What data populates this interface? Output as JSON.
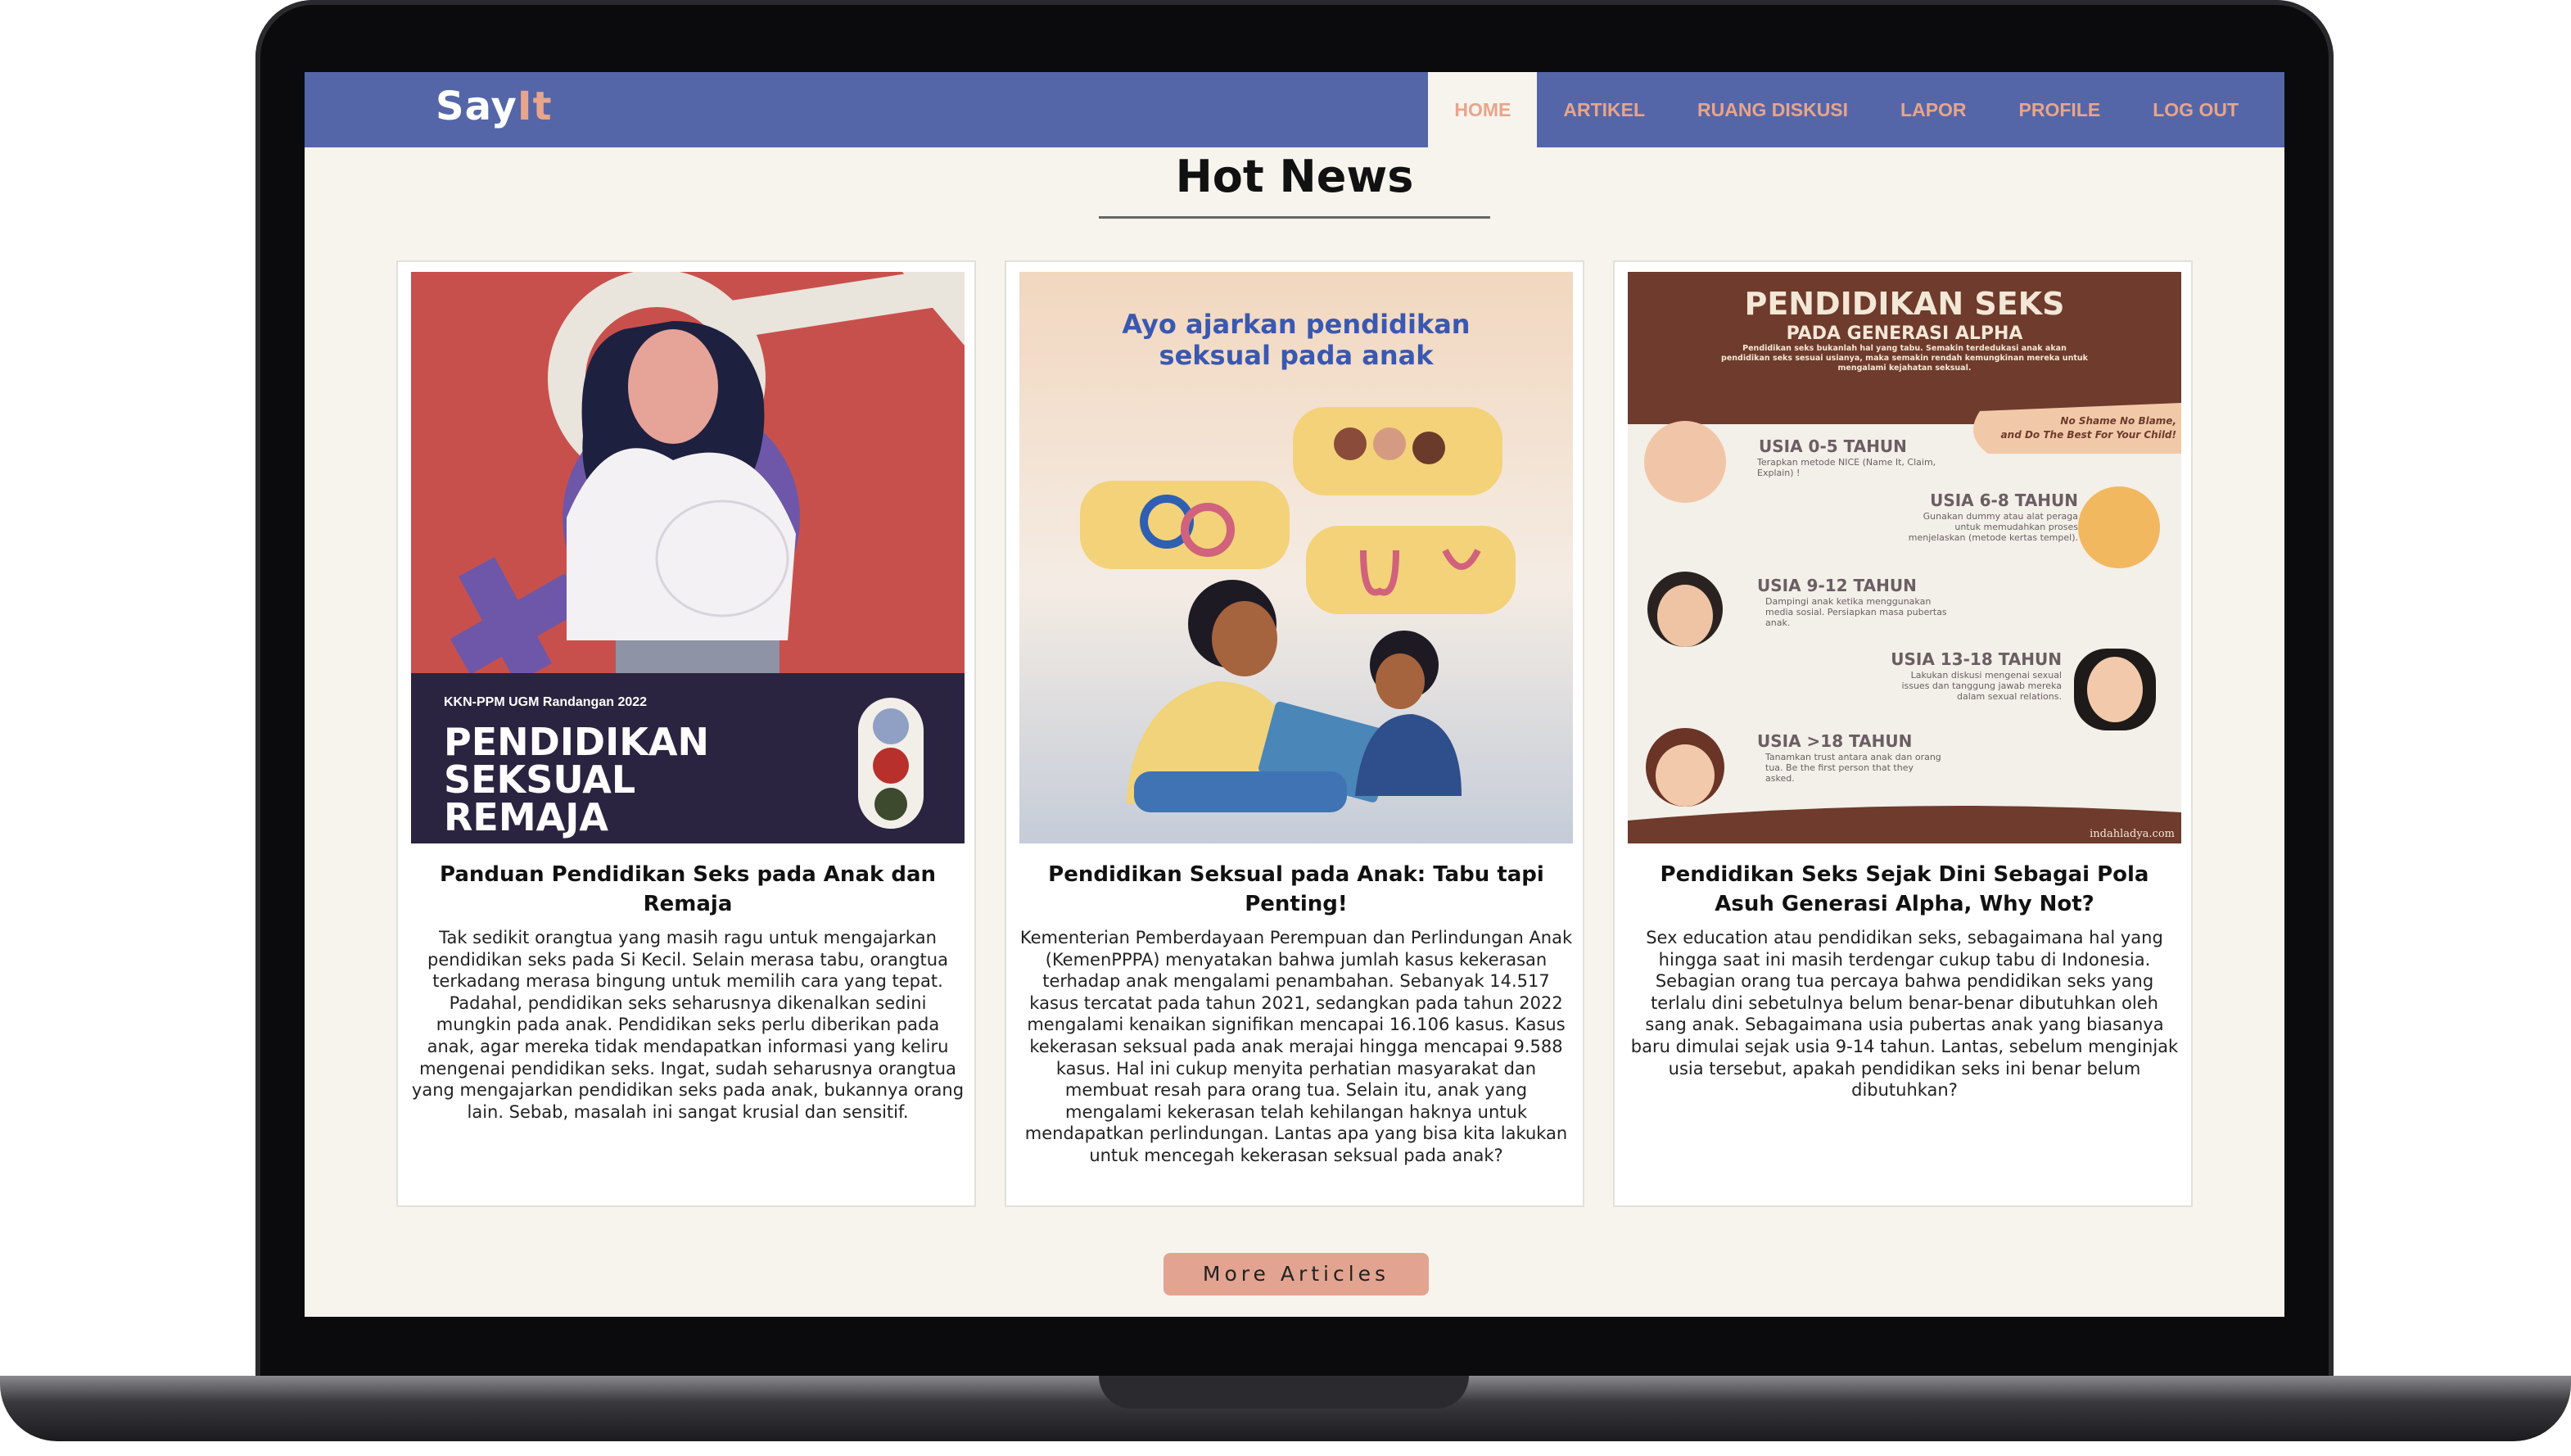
{
  "nav": {
    "logo_main": "Say",
    "logo_accent": "It",
    "items": [
      {
        "label": "HOME",
        "active": true
      },
      {
        "label": "ARTIKEL",
        "active": false
      },
      {
        "label": "RUANG DISKUSI",
        "active": false
      },
      {
        "label": "LAPOR",
        "active": false
      },
      {
        "label": "PROFILE",
        "active": false
      },
      {
        "label": "LOG OUT",
        "active": false
      }
    ]
  },
  "heading": "Hot News",
  "cards": [
    {
      "title": "Panduan Pendidikan Seks pada Anak dan Remaja",
      "body": "Tak sedikit orangtua yang masih ragu untuk mengajarkan pendidikan seks pada Si Kecil. Selain merasa tabu, orangtua terkadang merasa bingung untuk memilih cara yang tepat. Padahal, pendidikan seks seharusnya dikenalkan sedini mungkin pada anak. Pendidikan seks perlu diberikan pada anak, agar mereka tidak mendapatkan informasi yang keliru mengenai pendidikan seks. Ingat, sudah seharusnya orangtua yang mengajarkan pendidikan seks pada anak, bukannya orang lain. Sebab, masalah ini sangat krusial dan sensitif.",
      "image": {
        "caption_small": "KKN-PPM UGM Randangan 2022",
        "caption_big": [
          "PENDIDIKAN",
          "SEKSUAL",
          "REMAJA"
        ]
      }
    },
    {
      "title": "Pendidikan Seksual pada Anak: Tabu tapi Penting!",
      "body": "Kementerian Pemberdayaan Perempuan dan Perlindungan Anak (KemenPPPA) menyatakan bahwa jumlah kasus kekerasan terhadap anak mengalami penambahan. Sebanyak 14.517 kasus tercatat pada tahun 2021, sedangkan pada tahun 2022 mengalami kenaikan signifikan mencapai 16.106 kasus. Kasus kekerasan seksual pada anak merajai hingga mencapai 9.588 kasus. Hal ini cukup menyita perhatian masyarakat dan membuat resah para orang tua. Selain itu, anak yang mengalami kekerasan telah kehilangan haknya untuk mendapatkan perlindungan. Lantas apa yang bisa kita lakukan untuk mencegah kekerasan seksual pada anak?",
      "image": {
        "caption": [
          "Ayo ajarkan pendidikan",
          "seksual pada anak"
        ]
      }
    },
    {
      "title": "Pendidikan Seks Sejak Dini Sebagai Pola Asuh Generasi Alpha, Why Not?",
      "body": "Sex education atau pendidikan seks, sebagaimana hal yang hingga saat ini masih terdengar cukup tabu di Indonesia. Sebagian orang tua percaya bahwa pendidikan seks yang terlalu dini sebetulnya belum benar-benar dibutuhkan oleh sang anak. Sebagaimana usia pubertas anak yang biasanya baru dimulai sejak usia 9-14 tahun. Lantas, sebelum menginjak usia tersebut, apakah pendidikan seks ini benar belum dibutuhkan?",
      "image": {
        "header": "PENDIDIKAN SEKS",
        "subheader": "PADA GENERASI ALPHA",
        "blurb": "Pendidikan seks bukanlah hal yang tabu. Semakin terdedukasi anak akan pendidikan seks sesuai usianya, maka semakin rendah kemungkinan mereka untuk mengalami kejahatan seksual.",
        "bubble": [
          "No Shame No Blame,",
          "and Do The Best For Your Child!"
        ],
        "stages": [
          {
            "age": "USIA 0-5 TAHUN",
            "note": "Terapkan metode NICE (Name It, Claim, Explain) !"
          },
          {
            "age": "USIA 6-8 TAHUN",
            "note": "Gunakan dummy atau alat peraga untuk memudahkan proses menjelaskan (metode kertas tempel)."
          },
          {
            "age": "USIA 9-12 TAHUN",
            "note": "Dampingi anak ketika menggunakan media sosial. Persiapkan masa pubertas anak."
          },
          {
            "age": "USIA 13-18 TAHUN",
            "note": "Lakukan diskusi mengenai sexual issues dan tanggung jawab mereka dalam sexual relations."
          },
          {
            "age": "USIA >18 TAHUN",
            "note": "Tanamkan trust antara anak dan orang tua. Be the first person that they asked."
          }
        ],
        "credit": "indahladya.com"
      }
    }
  ],
  "more_button": "More Articles",
  "colors": {
    "nav_bg": "#5566a8",
    "accent": "#e7a58a",
    "page_bg": "#f7f4ee",
    "button_bg": "#e2a491"
  }
}
